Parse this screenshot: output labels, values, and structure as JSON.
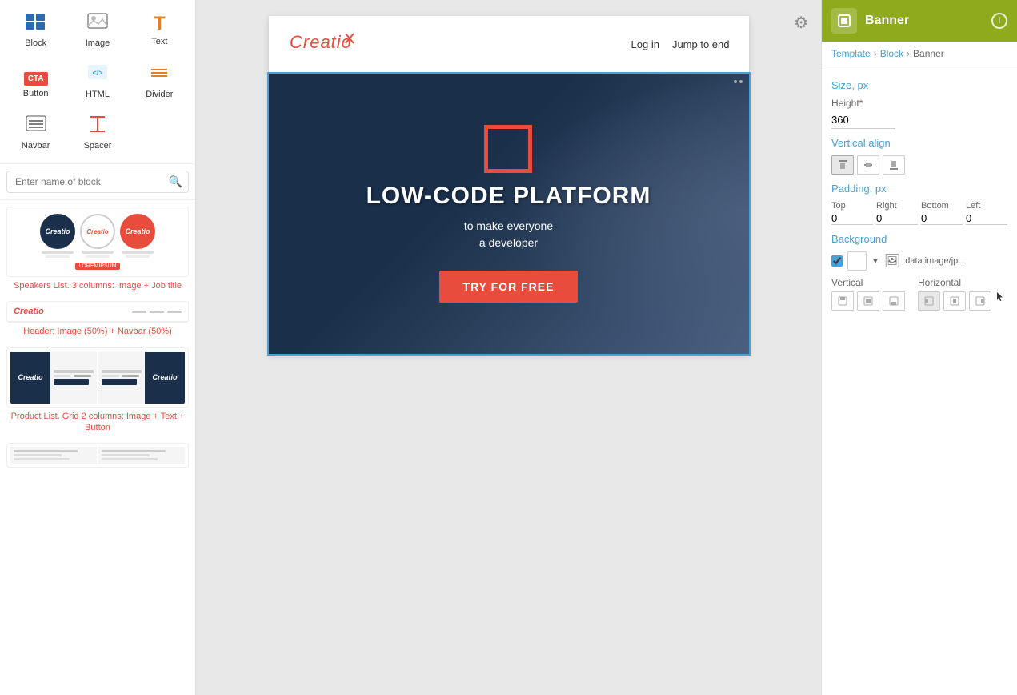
{
  "leftSidebar": {
    "blocks": [
      {
        "id": "block",
        "label": "Block",
        "icon": "▦"
      },
      {
        "id": "image",
        "label": "Image",
        "icon": "🖼"
      },
      {
        "id": "text",
        "label": "Text",
        "icon": "T"
      },
      {
        "id": "button",
        "label": "Button",
        "icon": "CTA"
      },
      {
        "id": "html",
        "label": "HTML",
        "icon": "</>"
      },
      {
        "id": "divider",
        "label": "Divider",
        "icon": "—"
      },
      {
        "id": "navbar",
        "label": "Navbar",
        "icon": "≡"
      },
      {
        "id": "spacer",
        "label": "Spacer",
        "icon": "↕"
      }
    ],
    "searchPlaceholder": "Enter name of block",
    "speakersLabel": "Speakers List. 3 columns: Image + Job title",
    "headerLabel": "Header: Image (50%) + Navbar (50%)",
    "productLabel": "Product List. Grid 2 columns: Image + Text + Button"
  },
  "canvas": {
    "header": {
      "logo": "Creatio",
      "navItems": [
        "Log in",
        "Jump to end"
      ]
    },
    "banner": {
      "title": "LOW-CODE PLATFORM",
      "subtitle": "to make everyone\na developer",
      "buttonLabel": "TRY FOR FREE"
    }
  },
  "rightSidebar": {
    "headerTitle": "Banner",
    "breadcrumb": [
      "Template",
      "Block",
      "Banner"
    ],
    "sizePx": {
      "sectionLabel": "Size, px",
      "heightLabel": "Height*",
      "heightValue": "360"
    },
    "verticalAlign": {
      "sectionLabel": "Vertical align",
      "options": [
        "top",
        "middle",
        "bottom"
      ]
    },
    "paddingPx": {
      "sectionLabel": "Padding, px",
      "labels": [
        "Top",
        "Right",
        "Bottom",
        "Left"
      ],
      "values": [
        "0",
        "0",
        "0",
        "0"
      ]
    },
    "background": {
      "sectionLabel": "Background",
      "imageText": "data:image/jp...",
      "verticalLabel": "Vertical",
      "horizontalLabel": "Horizontal",
      "verticalOptions": [
        "top",
        "center",
        "bottom"
      ],
      "horizontalOptions": [
        "left",
        "center",
        "right"
      ]
    }
  }
}
